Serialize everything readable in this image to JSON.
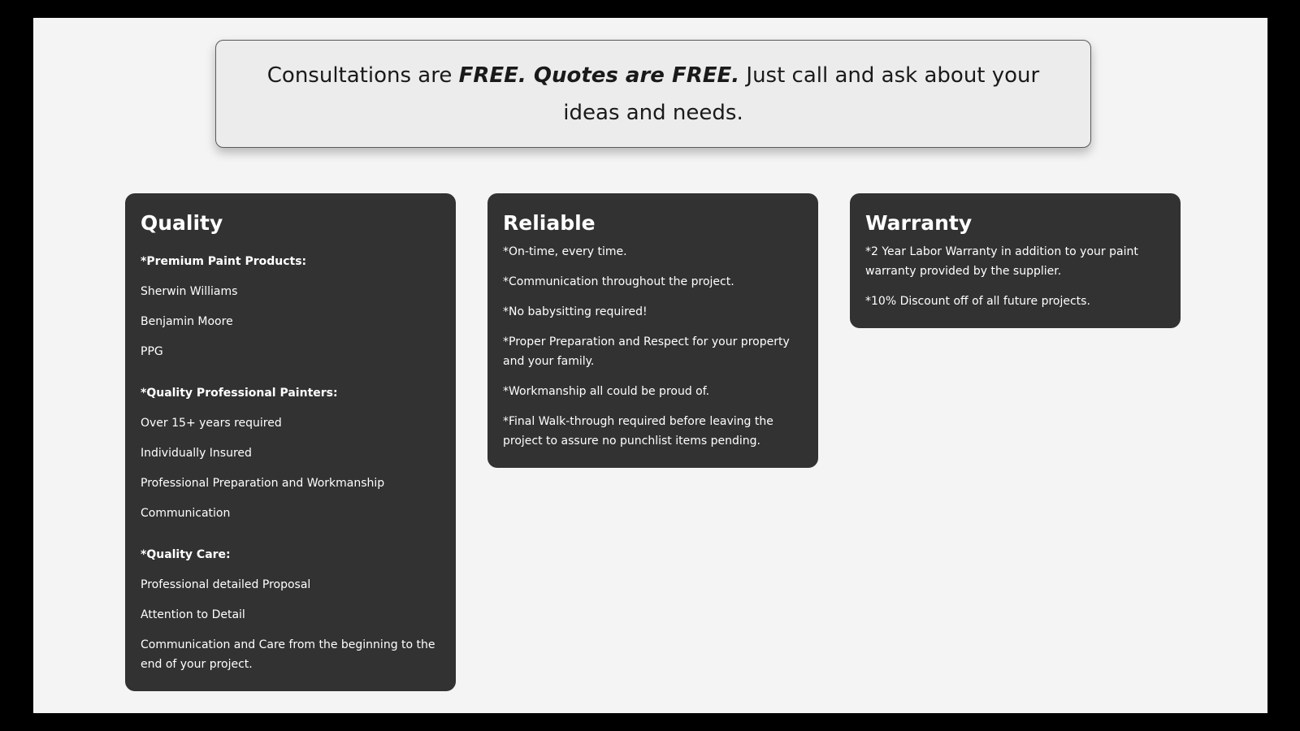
{
  "banner": {
    "part1": "Consultations are ",
    "part2": "FREE. Quotes are FREE.",
    "part3": " Just call and ask about your ideas and needs."
  },
  "cards": {
    "quality": {
      "title": "Quality",
      "groups": [
        {
          "heading": "*Premium Paint Products:",
          "items": [
            "Sherwin Williams",
            "Benjamin Moore",
            "PPG"
          ]
        },
        {
          "heading": "*Quality Professional Painters:",
          "items": [
            "Over 15+ years required",
            "Individually Insured",
            "Professional Preparation and Workmanship",
            "Communication"
          ]
        },
        {
          "heading": "*Quality Care:",
          "items": [
            "Professional detailed Proposal",
            "Attention to Detail",
            "Communication and Care from the beginning to the end of your project."
          ]
        }
      ]
    },
    "reliable": {
      "title": "Reliable",
      "items": [
        "*On-time, every time.",
        "*Communication throughout the project.",
        "*No babysitting required!",
        "*Proper Preparation and Respect for your property and your family.",
        "*Workmanship all could be proud of.",
        "*Final Walk-through required before leaving the project to assure no punchlist items pending."
      ]
    },
    "warranty": {
      "title": "Warranty",
      "items": [
        "*2 Year Labor Warranty in addition to your paint warranty provided by the supplier.",
        "*10% Discount off of all future projects."
      ]
    }
  }
}
